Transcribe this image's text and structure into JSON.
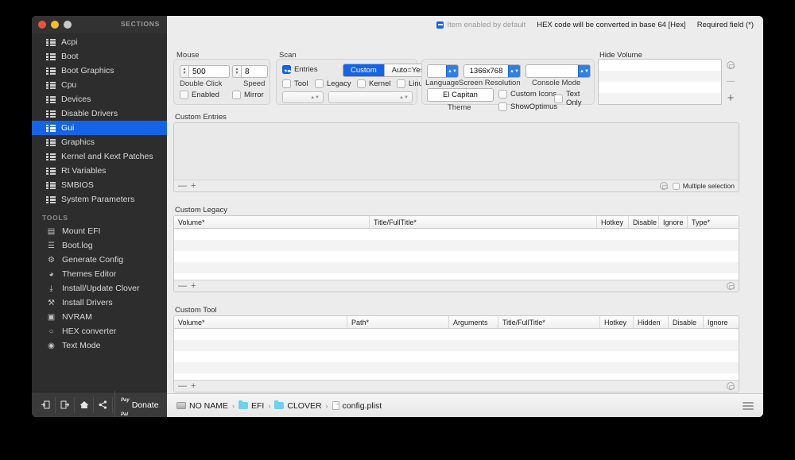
{
  "sidebar": {
    "title": "SECTIONS",
    "tools_label": "TOOLS",
    "sections": [
      {
        "label": "Acpi",
        "icon": "list-icon",
        "selected": false
      },
      {
        "label": "Boot",
        "icon": "list-icon",
        "selected": false
      },
      {
        "label": "Boot Graphics",
        "icon": "list-icon",
        "selected": false
      },
      {
        "label": "Cpu",
        "icon": "list-icon",
        "selected": false
      },
      {
        "label": "Devices",
        "icon": "list-icon",
        "selected": false
      },
      {
        "label": "Disable Drivers",
        "icon": "list-icon",
        "selected": false
      },
      {
        "label": "Gui",
        "icon": "list-icon",
        "selected": true
      },
      {
        "label": "Graphics",
        "icon": "list-icon",
        "selected": false
      },
      {
        "label": "Kernel and Kext Patches",
        "icon": "list-icon",
        "selected": false
      },
      {
        "label": "Rt Variables",
        "icon": "list-icon",
        "selected": false
      },
      {
        "label": "SMBIOS",
        "icon": "list-icon",
        "selected": false
      },
      {
        "label": "System Parameters",
        "icon": "list-icon",
        "selected": false
      }
    ],
    "tools": [
      {
        "label": "Mount EFI",
        "icon": "disk-mount-icon",
        "glyph": "▤"
      },
      {
        "label": "Boot.log",
        "icon": "log-file-icon",
        "glyph": "☰"
      },
      {
        "label": "Generate Config",
        "icon": "gear-icon",
        "glyph": "⚙"
      },
      {
        "label": "Themes Editor",
        "icon": "palette-icon",
        "glyph": "◕"
      },
      {
        "label": "Install/Update Clover",
        "icon": "download-icon",
        "glyph": "⤓"
      },
      {
        "label": "Install Drivers",
        "icon": "tools-icon",
        "glyph": "⚒"
      },
      {
        "label": "NVRAM",
        "icon": "chip-icon",
        "glyph": "▣"
      },
      {
        "label": "HEX converter",
        "icon": "refresh-icon",
        "glyph": "○"
      },
      {
        "label": "Text Mode",
        "icon": "eye-icon",
        "glyph": "◉"
      }
    ],
    "bottom_toolbar": {
      "buttons": [
        {
          "name": "import-button",
          "glyph": "⮊"
        },
        {
          "name": "export-button",
          "glyph": "⮌"
        },
        {
          "name": "home-button",
          "glyph": "⌂"
        },
        {
          "name": "share-button",
          "glyph": "≪"
        }
      ],
      "paypal_line1": "Pay",
      "paypal_line2": "Pal",
      "donate_label": "Donate"
    }
  },
  "header": {
    "item_enabled_default": "Item enabled by default",
    "hex_note": "HEX code will be converted in base 64 [Hex]",
    "required_field": "Required field (*)"
  },
  "mouse": {
    "title": "Mouse",
    "double_click_value": "500",
    "double_click_label": "Double Click",
    "speed_value": "8",
    "speed_label": "Speed",
    "enabled_label": "Enabled",
    "enabled_checked": false,
    "mirror_label": "Mirror",
    "mirror_checked": false
  },
  "scan": {
    "title": "Scan",
    "entries_label": "Entries",
    "entries_checked": true,
    "seg_custom": "Custom",
    "seg_auto": "Auto=Yes",
    "seg_selected": "Custom",
    "tool_label": "Tool",
    "tool_checked": false,
    "legacy_label": "Legacy",
    "legacy_checked": false,
    "kernel_label": "Kernel",
    "kernel_checked": false,
    "linux_label": "Linux",
    "linux_checked": false
  },
  "display": {
    "language_value": "",
    "language_label": "Language",
    "resolution_value": "1366x768",
    "resolution_label": "Screen Resolution",
    "console_value": "",
    "console_label": "Console Mode",
    "theme_value": "El Capitan",
    "theme_label": "Theme",
    "custom_icons_label": "Custom Icons",
    "custom_icons_checked": false,
    "text_only_label": "Text Only",
    "text_only_checked": false,
    "show_optimus_label": "ShowOptimus",
    "show_optimus_checked": false
  },
  "hide_volume": {
    "title": "Hide Volume",
    "rows": [
      "",
      "",
      "",
      ""
    ],
    "add_glyph": "+",
    "remove_glyph": "—"
  },
  "custom_entries": {
    "title": "Custom Entries",
    "multiple_selection_label": "Multiple selection",
    "multiple_selection_checked": false,
    "remove_glyph": "—",
    "add_glyph": "+"
  },
  "custom_legacy": {
    "title": "Custom Legacy",
    "columns": [
      "Volume*",
      "Title/FullTitle*",
      "Hotkey",
      "Disable",
      "Ignore",
      "Type*"
    ],
    "rows": [],
    "remove_glyph": "—",
    "add_glyph": "+"
  },
  "custom_tool": {
    "title": "Custom Tool",
    "columns": [
      "Volume*",
      "Path*",
      "Arguments",
      "Title/FullTitle*",
      "Hotkey",
      "Hidden",
      "Disable",
      "Ignore"
    ],
    "rows": [],
    "remove_glyph": "—",
    "add_glyph": "+"
  },
  "breadcrumb": {
    "items": [
      {
        "label": "NO NAME",
        "icon": "disk-icon"
      },
      {
        "label": "EFI",
        "icon": "folder-icon"
      },
      {
        "label": "CLOVER",
        "icon": "folder-icon"
      },
      {
        "label": "config.plist",
        "icon": "document-icon"
      }
    ],
    "separator": "›"
  },
  "colors": {
    "accent": "#1564e8",
    "window_bg": "#ececec",
    "sidebar_bg": "#2d2d2d",
    "folder": "#6fd0ef"
  }
}
